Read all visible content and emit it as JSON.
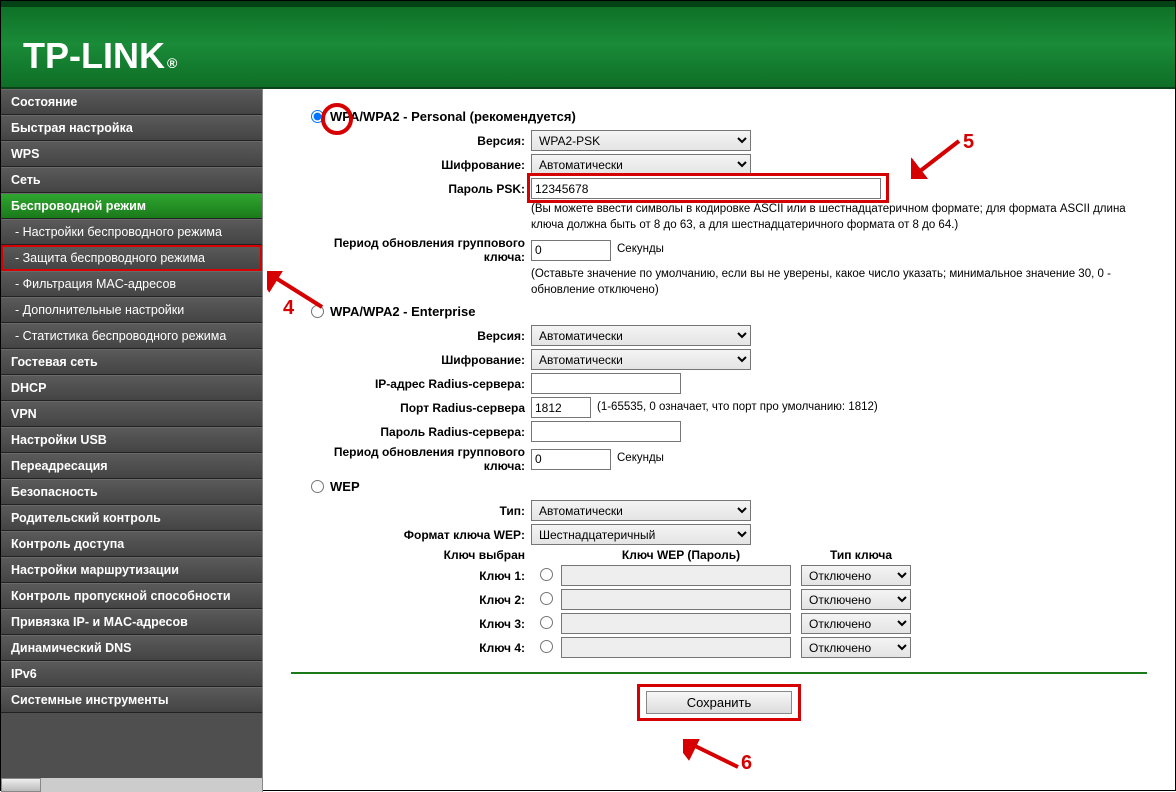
{
  "brand": "TP-LINK",
  "sidebar": {
    "items": [
      {
        "label": "Состояние",
        "type": "bold"
      },
      {
        "label": "Быстрая настройка",
        "type": "bold"
      },
      {
        "label": "WPS",
        "type": "bold"
      },
      {
        "label": "Сеть",
        "type": "bold"
      },
      {
        "label": "Беспроводной режим",
        "type": "bold active-parent"
      },
      {
        "label": "- Настройки беспроводного режима",
        "type": "sub"
      },
      {
        "label": "- Защита беспроводного режима",
        "type": "sub red-box"
      },
      {
        "label": "- Фильтрация MAC-адресов",
        "type": "sub"
      },
      {
        "label": "- Дополнительные настройки",
        "type": "sub"
      },
      {
        "label": "- Статистика беспроводного режима",
        "type": "sub"
      },
      {
        "label": "Гостевая сеть",
        "type": "bold"
      },
      {
        "label": "DHCP",
        "type": "bold"
      },
      {
        "label": "VPN",
        "type": "bold"
      },
      {
        "label": "Настройки USB",
        "type": "bold"
      },
      {
        "label": "Переадресация",
        "type": "bold"
      },
      {
        "label": "Безопасность",
        "type": "bold"
      },
      {
        "label": "Родительский контроль",
        "type": "bold"
      },
      {
        "label": "Контроль доступа",
        "type": "bold"
      },
      {
        "label": "Настройки маршрутизации",
        "type": "bold"
      },
      {
        "label": "Контроль пропускной способности",
        "type": "bold"
      },
      {
        "label": "Привязка IP- и MAC-адресов",
        "type": "bold"
      },
      {
        "label": "Динамический DNS",
        "type": "bold"
      },
      {
        "label": "IPv6",
        "type": "bold"
      },
      {
        "label": "Системные инструменты",
        "type": "bold"
      }
    ]
  },
  "personal": {
    "title": "WPA/WPA2 - Personal (рекомендуется)",
    "version_label": "Версия:",
    "version_value": "WPA2-PSK",
    "enc_label": "Шифрование:",
    "enc_value": "Автоматически",
    "psk_label": "Пароль PSK:",
    "psk_value": "12345678",
    "psk_note": "(Вы можете ввести символы в кодировке ASCII или в шестнадцатеричном формате; для формата ASCII длина ключа должна быть от 8 до 63, а для шестнадцатеричного формата от 8 до 64.)",
    "gk_label": "Период обновления группового ключа:",
    "gk_value": "0",
    "gk_unit": "Секунды",
    "gk_note": "(Оставьте значение по умолчанию, если вы не уверены, какое число указать; минимальное значение 30, 0 - обновление отключено)"
  },
  "enterprise": {
    "title": "WPA/WPA2 - Enterprise",
    "version_label": "Версия:",
    "version_value": "Автоматически",
    "enc_label": "Шифрование:",
    "enc_value": "Автоматически",
    "radius_ip_label": "IP-адрес Radius-сервера:",
    "radius_ip_value": "",
    "radius_port_label": "Порт Radius-сервера",
    "radius_port_value": "1812",
    "radius_port_note": "(1-65535, 0 означает, что порт про умолчанию: 1812)",
    "radius_pw_label": "Пароль Radius-сервера:",
    "radius_pw_value": "",
    "gk_label": "Период обновления группового ключа:",
    "gk_value": "0",
    "gk_unit": "Секунды"
  },
  "wep": {
    "title": "WEP",
    "type_label": "Тип:",
    "type_value": "Автоматически",
    "fmt_label": "Формат ключа WEP:",
    "fmt_value": "Шестнадцатеричный",
    "sel_label": "Ключ выбран",
    "col_pw": "Ключ WEP (Пароль)",
    "col_type": "Тип ключа",
    "keys": [
      {
        "label": "Ключ 1:",
        "type": "Отключено"
      },
      {
        "label": "Ключ 2:",
        "type": "Отключено"
      },
      {
        "label": "Ключ 3:",
        "type": "Отключено"
      },
      {
        "label": "Ключ 4:",
        "type": "Отключено"
      }
    ]
  },
  "save": "Сохранить",
  "annotations": {
    "n4": "4",
    "n5": "5",
    "n6": "6"
  }
}
